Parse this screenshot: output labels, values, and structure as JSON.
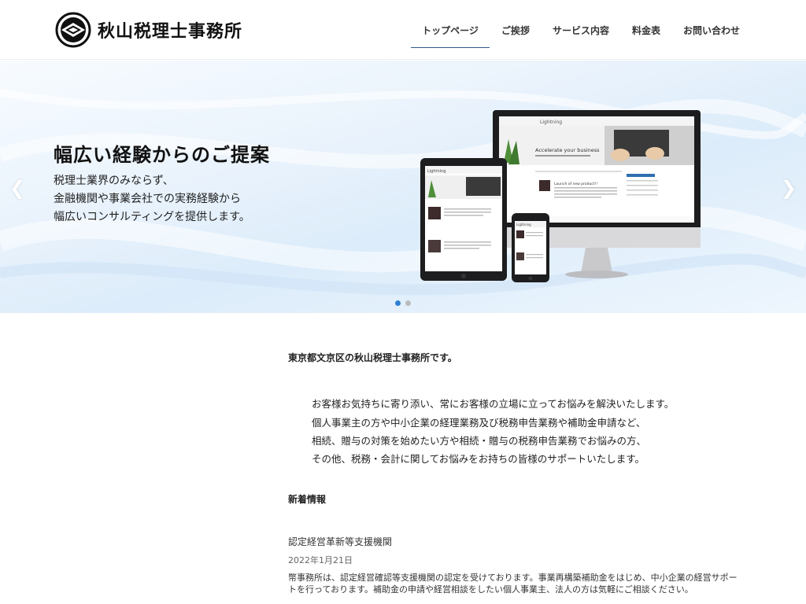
{
  "header": {
    "logo_text": "秋山税理士事務所",
    "nav": [
      {
        "label": "トップページ",
        "active": true
      },
      {
        "label": "ご挨拶"
      },
      {
        "label": "サービス内容"
      },
      {
        "label": "料金表"
      },
      {
        "label": "お問い合わせ"
      }
    ]
  },
  "hero": {
    "title": "幅広い経験からのご提案",
    "lines": [
      "税理士業界のみならず、",
      "金融機関や事業会社での実務経験から",
      "幅広いコンサルティングを提供します。"
    ],
    "prev_icon": "chevron-left-icon",
    "next_icon": "chevron-right-icon",
    "device_image": {
      "brand": "Lightning",
      "monitor_heading": "Accelerate your business",
      "post_title": "Launch of new product!!"
    },
    "slides_total": 2,
    "slide_active": 1
  },
  "main": {
    "intro_title": "東京都文京区の秋山税理士事務所です。",
    "paragraphs": [
      "お客様お気持ちに寄り添い、常にお客様の立場に立ってお悩みを解決いたします。",
      "個人事業主の方や中小企業の経理業務及び税務申告業務や補助金申請など、",
      "相続、贈与の対策を始めたい方や相続・贈与の税務申告業務でお悩みの方、",
      "その他、税務・会計に関してお悩みをお持ちの皆様のサポートいたします。"
    ],
    "news_heading": "新着情報",
    "news": {
      "title": "認定経営革新等支援機関",
      "date": "2022年1月21日",
      "body": [
        "幣事務所は、認定経営確認等支援機関の認定を受けております。事業再構築補助金をはじめ、中小企業の経営サポー",
        "トを行っております。補助金の申請や経営相談をしたい個人事業主、法人の方は気軽にご相談ください。"
      ]
    }
  },
  "colors": {
    "accent": "#2f7fd0",
    "nav_underline": "#2f5c8a"
  }
}
